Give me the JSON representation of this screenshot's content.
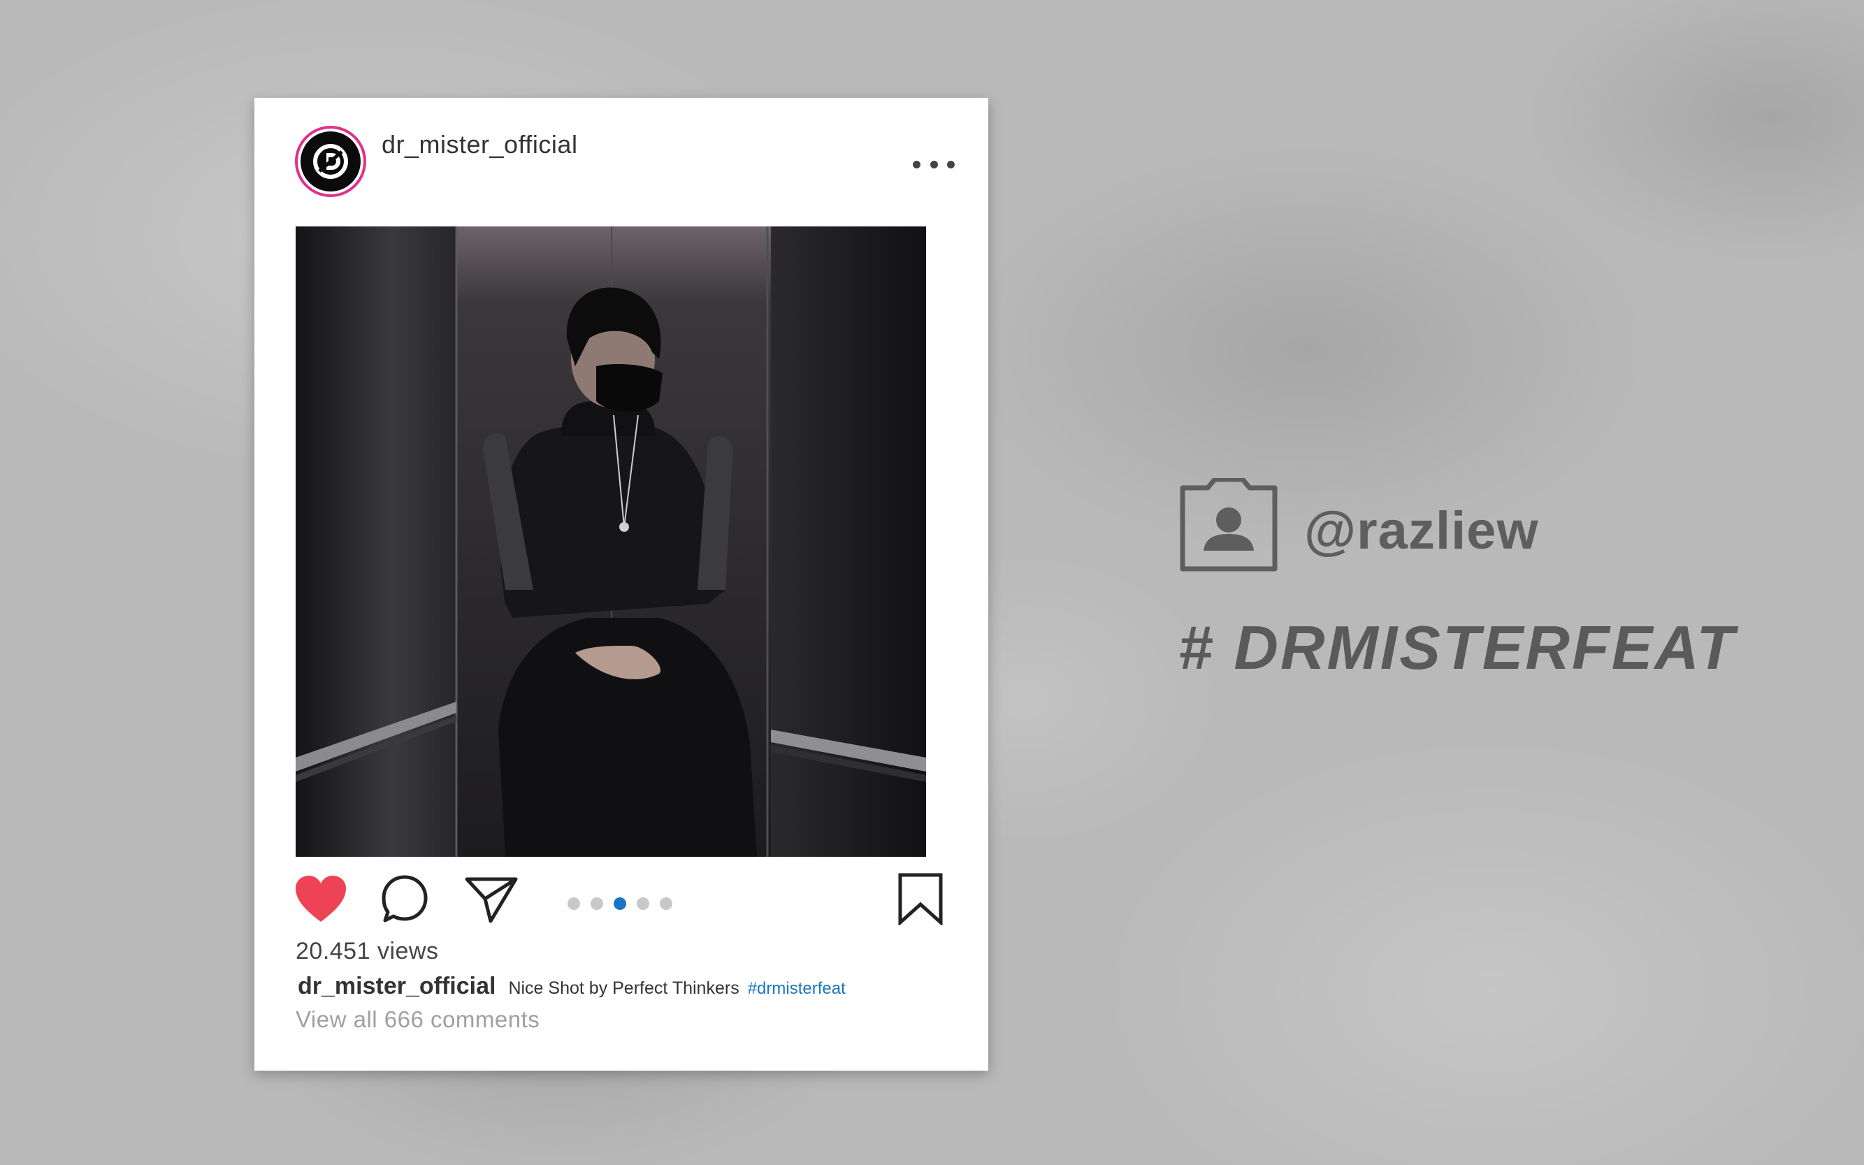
{
  "post": {
    "username": "dr_mister_official",
    "views": "20.451 views",
    "caption_user": "dr_mister_official",
    "caption_text": "Nice Shot by Perfect Thinkers",
    "caption_hashtag": "#drmisterfeat",
    "comments_link": "View all 666 comments",
    "carousel": {
      "count": 5,
      "active_index": 2
    },
    "liked": true
  },
  "credit": {
    "handle": "@razliew",
    "hashtag": "# DRMISTERFEAT"
  },
  "icons": [
    "avatar-logo-icon",
    "more-options-icon",
    "heart-icon",
    "comment-icon",
    "share-icon",
    "bookmark-icon",
    "profile-card-icon"
  ],
  "colors": {
    "heart": "#ee4256",
    "avatar_ring": "#e1308a",
    "active_dot": "#1a76c2",
    "hashtag_link": "#1a76c2",
    "background": "#b9b9b9"
  }
}
